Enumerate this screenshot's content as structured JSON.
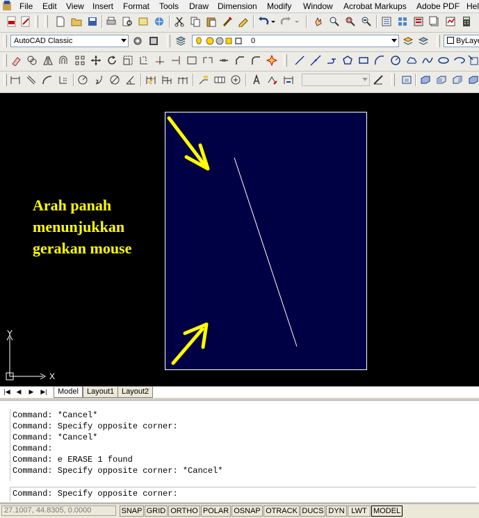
{
  "menu": {
    "items": [
      "File",
      "Edit",
      "View",
      "Insert",
      "Format",
      "Tools",
      "Draw",
      "Dimension",
      "Modify",
      "Window",
      "Acrobat Markups",
      "Adobe PDF",
      "Hel"
    ]
  },
  "workspace": {
    "value": "AutoCAD Classic"
  },
  "layer": {
    "value": "0"
  },
  "color": {
    "value": "ByLaye"
  },
  "annotation": {
    "text": "Arah panah\nmenunjukkan\ngerakan mouse",
    "color": "#ffff00"
  },
  "ucs": {
    "x_label": "X",
    "y_label": "Y"
  },
  "layout_tabs": [
    "Model",
    "Layout1",
    "Layout2"
  ],
  "command": {
    "history": [
      "Command: *Cancel*",
      "Command: Specify opposite corner:",
      "Command: *Cancel*",
      "Command:",
      "Command: e ERASE 1 found",
      "Command: Specify opposite corner: *Cancel*"
    ],
    "prompt": "Command: Specify opposite corner:"
  },
  "status": {
    "coords": "27.1007, 44.8305, 0.0000",
    "toggles": [
      "SNAP",
      "GRID",
      "ORTHO",
      "POLAR",
      "OSNAP",
      "OTRACK",
      "DUCS",
      "DYN",
      "LWT",
      "MODEL"
    ]
  },
  "colors": {
    "drawing_bg": "#000000",
    "paper_bg": "#000044",
    "arrow": "#ffff00"
  }
}
